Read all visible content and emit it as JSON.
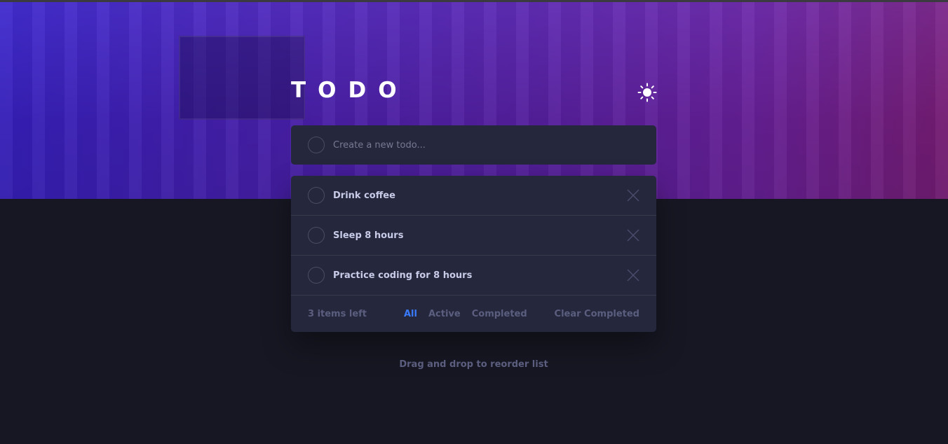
{
  "app": {
    "title": "TODO"
  },
  "new_todo": {
    "placeholder": "Create a new todo..."
  },
  "todos": [
    {
      "text": "Drink coffee",
      "completed": false
    },
    {
      "text": "Sleep 8 hours",
      "completed": false
    },
    {
      "text": "Practice coding for 8 hours",
      "completed": false
    }
  ],
  "footer": {
    "items_left": "3 items left",
    "filters": [
      "All",
      "Active",
      "Completed"
    ],
    "active_filter": "All",
    "clear_label": "Clear Completed"
  },
  "hint": "Drag and drop to reorder list",
  "icons": {
    "theme_toggle": "sun-icon",
    "delete": "cross-icon",
    "check": "circle-check"
  },
  "colors": {
    "accent": "#3a7bfd",
    "card": "#25273c",
    "background": "#161722",
    "hero_start": "#3a22c8",
    "hero_end": "#7e1f7c"
  }
}
